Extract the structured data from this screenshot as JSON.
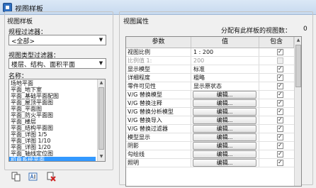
{
  "window": {
    "title": "视图样板"
  },
  "left": {
    "group_title": "视图样板",
    "discipline_filter_label": "规程过滤器：",
    "discipline_filter_value": "<全部>",
    "view_type_filter_label": "视图类型过滤器：",
    "view_type_filter_value": "楼层、结构、面积平面",
    "names_label": "名称：",
    "names": [
      "场地平面",
      "平面_地下室",
      "平面_基础平面配图",
      "平面_屋顶平面图",
      "平面_平面图",
      "平面_防火平面图",
      "平面_楼层",
      "平面_结构平面图",
      "平面_详图 1/5",
      "平面_详图 1/10",
      "平面_详图 1/20",
      "平面_轴线定位图",
      "机电系统平面"
    ],
    "selected_index": 12,
    "tools": [
      "duplicate-icon",
      "rename-icon",
      "delete-icon"
    ]
  },
  "right": {
    "group_title": "视图属性",
    "assigned_count_label": "分配有此样板的视图数：",
    "assigned_count": "0",
    "columns": [
      "参数",
      "值",
      "包含"
    ],
    "rows": [
      {
        "param": "视图比例",
        "value": "1 : 200",
        "type": "text",
        "include": true,
        "disabled": false
      },
      {
        "param": "比例值 1:",
        "value": "200",
        "type": "text",
        "include": false,
        "disabled": true
      },
      {
        "param": "显示模型",
        "value": "标准",
        "type": "text",
        "include": true,
        "disabled": false
      },
      {
        "param": "详细程度",
        "value": "粗略",
        "type": "text",
        "include": true,
        "disabled": false
      },
      {
        "param": "零件可见性",
        "value": "显示原状态",
        "type": "text",
        "include": true,
        "disabled": false
      },
      {
        "param": "V/G 替换模型",
        "value": "编辑...",
        "type": "button",
        "include": true,
        "disabled": false
      },
      {
        "param": "V/G 替换注释",
        "value": "编辑...",
        "type": "button",
        "include": true,
        "disabled": false
      },
      {
        "param": "V/G 替换分析模型",
        "value": "编辑...",
        "type": "button",
        "include": true,
        "disabled": false
      },
      {
        "param": "V/G 替换导入",
        "value": "编辑...",
        "type": "button",
        "include": true,
        "disabled": false
      },
      {
        "param": "V/G 替换过滤器",
        "value": "编辑...",
        "type": "button",
        "include": true,
        "disabled": false
      },
      {
        "param": "模型显示",
        "value": "编辑...",
        "type": "button",
        "include": true,
        "disabled": false
      },
      {
        "param": "阴影",
        "value": "编辑...",
        "type": "button",
        "include": true,
        "disabled": false
      },
      {
        "param": "勾绘线",
        "value": "编辑...",
        "type": "button",
        "include": true,
        "disabled": false
      },
      {
        "param": "照明",
        "value": "编辑...",
        "type": "button",
        "include": true,
        "disabled": false
      }
    ]
  }
}
